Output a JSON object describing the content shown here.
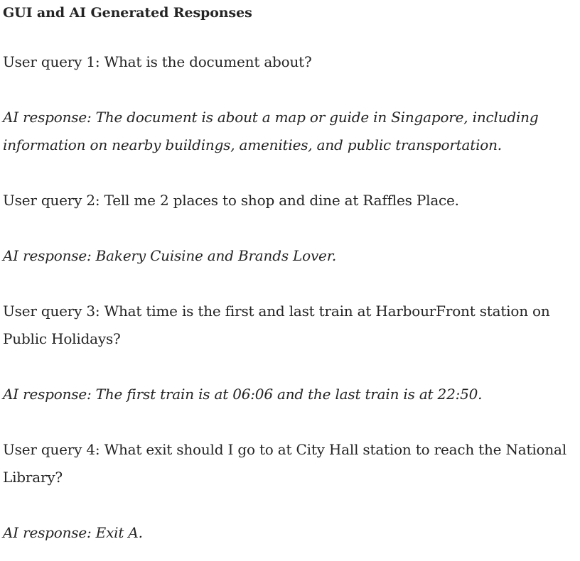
{
  "document": {
    "title": "GUI and AI Generated Responses",
    "exchanges": [
      {
        "query": "User query 1: What is the document about?",
        "response": "AI response: The document is about a map or guide in Singapore, including information on nearby buildings, amenities, and public transportation."
      },
      {
        "query": "User query 2: Tell me 2 places to shop and dine at Raffles Place.",
        "response": "AI response: Bakery Cuisine and Brands Lover."
      },
      {
        "query": "User query 3: What time is the first and last train at HarbourFront station on Public Holidays?",
        "response": "AI response: The first train is at 06:06 and the last train is at 22:50."
      },
      {
        "query": "User query 4: What exit should I go to at City Hall station to reach the National Library?",
        "response": "AI response: Exit A."
      }
    ]
  }
}
